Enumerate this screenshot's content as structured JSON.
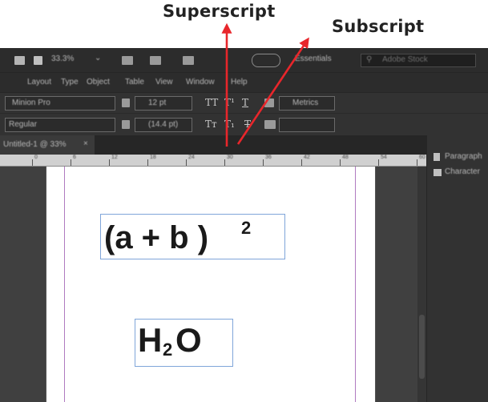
{
  "callouts": {
    "superscript": "Superscript",
    "subscript": "Subscript"
  },
  "app": {
    "zoom": "33.3%",
    "workspace": "Essentials",
    "search_placeholder": "Adobe Stock",
    "menu": [
      "Layout",
      "Type",
      "Object",
      "Table",
      "View",
      "Window",
      "Help"
    ],
    "font_family": "Minion Pro",
    "font_style": "Regular",
    "font_size": "12 pt",
    "leading": "(14.4 pt)",
    "language": "Metrics",
    "tab_label": "Untitled-1 @ 33%",
    "panel_items": [
      "Paragraph",
      "Character"
    ]
  },
  "type_buttons": {
    "all_caps": "TT",
    "superscript": "T¹",
    "underline": "T",
    "small_caps": "Tᴛ",
    "subscript": "T₁",
    "strikethrough": "T"
  },
  "ruler_ticks": [
    "0",
    "6",
    "12",
    "18",
    "24",
    "30",
    "36",
    "42",
    "48",
    "54",
    "60"
  ],
  "document": {
    "formula1": {
      "base": "(a + b )",
      "exponent": "2"
    },
    "formula2": {
      "prefix": "H",
      "subscript": "2",
      "suffix": "O"
    }
  },
  "colors": {
    "annotation_arrow": "#e8262b",
    "frame_border": "#7fa5d9",
    "margin_guide": "#b07bc0"
  }
}
